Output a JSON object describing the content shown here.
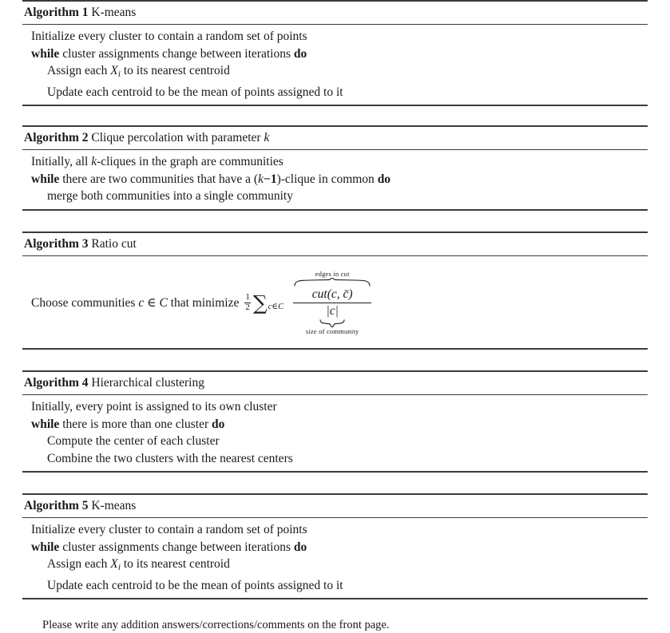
{
  "document": {
    "algorithms": [
      {
        "number": "Algorithm 1",
        "title": "K-means",
        "lines": [
          {
            "indent": 1,
            "text": "Initialize every cluster to contain a random set of points"
          },
          {
            "indent": 1,
            "text": "while cluster assignments change between iterations do"
          },
          {
            "indent": 2,
            "text": "Assign each Xi to its nearest centroid"
          },
          {
            "indent": 2,
            "text": "Update each centroid to be the mean of points assigned to it"
          }
        ]
      },
      {
        "number": "Algorithm 2",
        "title": "Clique percolation with parameter k",
        "lines": [
          {
            "indent": 1,
            "text": "Initially, all k-cliques in the graph are communities"
          },
          {
            "indent": 1,
            "text": "while there are two communities that have a (k − 1)-clique in common do"
          },
          {
            "indent": 2,
            "text": "merge both communities into a single community"
          }
        ]
      },
      {
        "number": "Algorithm 3",
        "title": "Ratio cut",
        "lines": [
          {
            "indent": 1,
            "text": "Choose communities c ∈ C that minimize ½ Σc∈C cut(c, c̄) / |c|"
          }
        ]
      },
      {
        "number": "Algorithm 4",
        "title": "Hierarchical clustering",
        "lines": [
          {
            "indent": 1,
            "text": "Initially, every point is assigned to its own cluster"
          },
          {
            "indent": 1,
            "text": "while there is more than one cluster do"
          },
          {
            "indent": 2,
            "text": "Compute the center of each cluster"
          },
          {
            "indent": 2,
            "text": "Combine the two clusters with the nearest centers"
          }
        ]
      },
      {
        "number": "Algorithm 5",
        "title": "K-means",
        "lines": [
          {
            "indent": 1,
            "text": "Initialize every cluster to contain a random set of points"
          },
          {
            "indent": 1,
            "text": "while cluster assignments change between iterations do"
          },
          {
            "indent": 2,
            "text": "Assign each Xi to its nearest centroid"
          },
          {
            "indent": 2,
            "text": "Update each centroid to be the mean of points assigned to it"
          }
        ]
      }
    ],
    "algo1": {
      "number": "Algorithm 1",
      "title": "K-means",
      "l1_a": "Initialize every cluster to contain a random set of points",
      "l2_kw": "while",
      "l2_b": "cluster assignments change between iterations",
      "l2_kw2": "do",
      "l3_a": "Assign each",
      "l3_x": "X",
      "l3_sub": "i",
      "l3_b": "to its nearest centroid",
      "l4_a": "Update each centroid to be the mean of points assigned to it"
    },
    "algo2": {
      "number": "Algorithm 2",
      "title_a": "Clique percolation with parameter",
      "title_k": "k",
      "l1_a": "Initially, all",
      "l1_k": "k",
      "l1_b": "-cliques in the graph are communities",
      "l2_kw": "while",
      "l2_a": "there are two communities that have a (",
      "l2_k": "k",
      "l2_minus": "−",
      "l2_one": "1",
      "l2_b": ")-clique in common",
      "l2_kw2": "do",
      "l3_a": "merge both communities into a single community"
    },
    "algo3": {
      "number": "Algorithm 3",
      "title": "Ratio cut",
      "lead": "Choose communities",
      "var_c": "c",
      "elem": "∈",
      "var_C": "C",
      "mid": "that minimize",
      "half_num": "1",
      "half_den": "2",
      "sigma": "∑",
      "sigma_sub": "c∈C",
      "overbrace_label": "edges in cut",
      "numerator_fn": "cut",
      "numerator_args": "(c, c̄)",
      "denominator": "|c|",
      "underbrace_label": "size of community"
    },
    "algo4": {
      "number": "Algorithm 4",
      "title": "Hierarchical clustering",
      "l1_a": "Initially, every point is assigned to its own cluster",
      "l2_kw": "while",
      "l2_b": "there is more than one cluster",
      "l2_kw2": "do",
      "l3_a": "Compute the center of each cluster",
      "l4_a": "Combine the two clusters with the nearest centers"
    },
    "algo5": {
      "number": "Algorithm 5",
      "title": "K-means",
      "l1_a": "Initialize every cluster to contain a random set of points",
      "l2_kw": "while",
      "l2_b": "cluster assignments change between iterations",
      "l2_kw2": "do",
      "l3_a": "Assign each",
      "l3_x": "X",
      "l3_sub": "i",
      "l3_b": "to its nearest centroid",
      "l4_a": "Update each centroid to be the mean of points assigned to it"
    },
    "footer": {
      "note": "Please write any addition answers/corrections/comments on the front page."
    }
  }
}
